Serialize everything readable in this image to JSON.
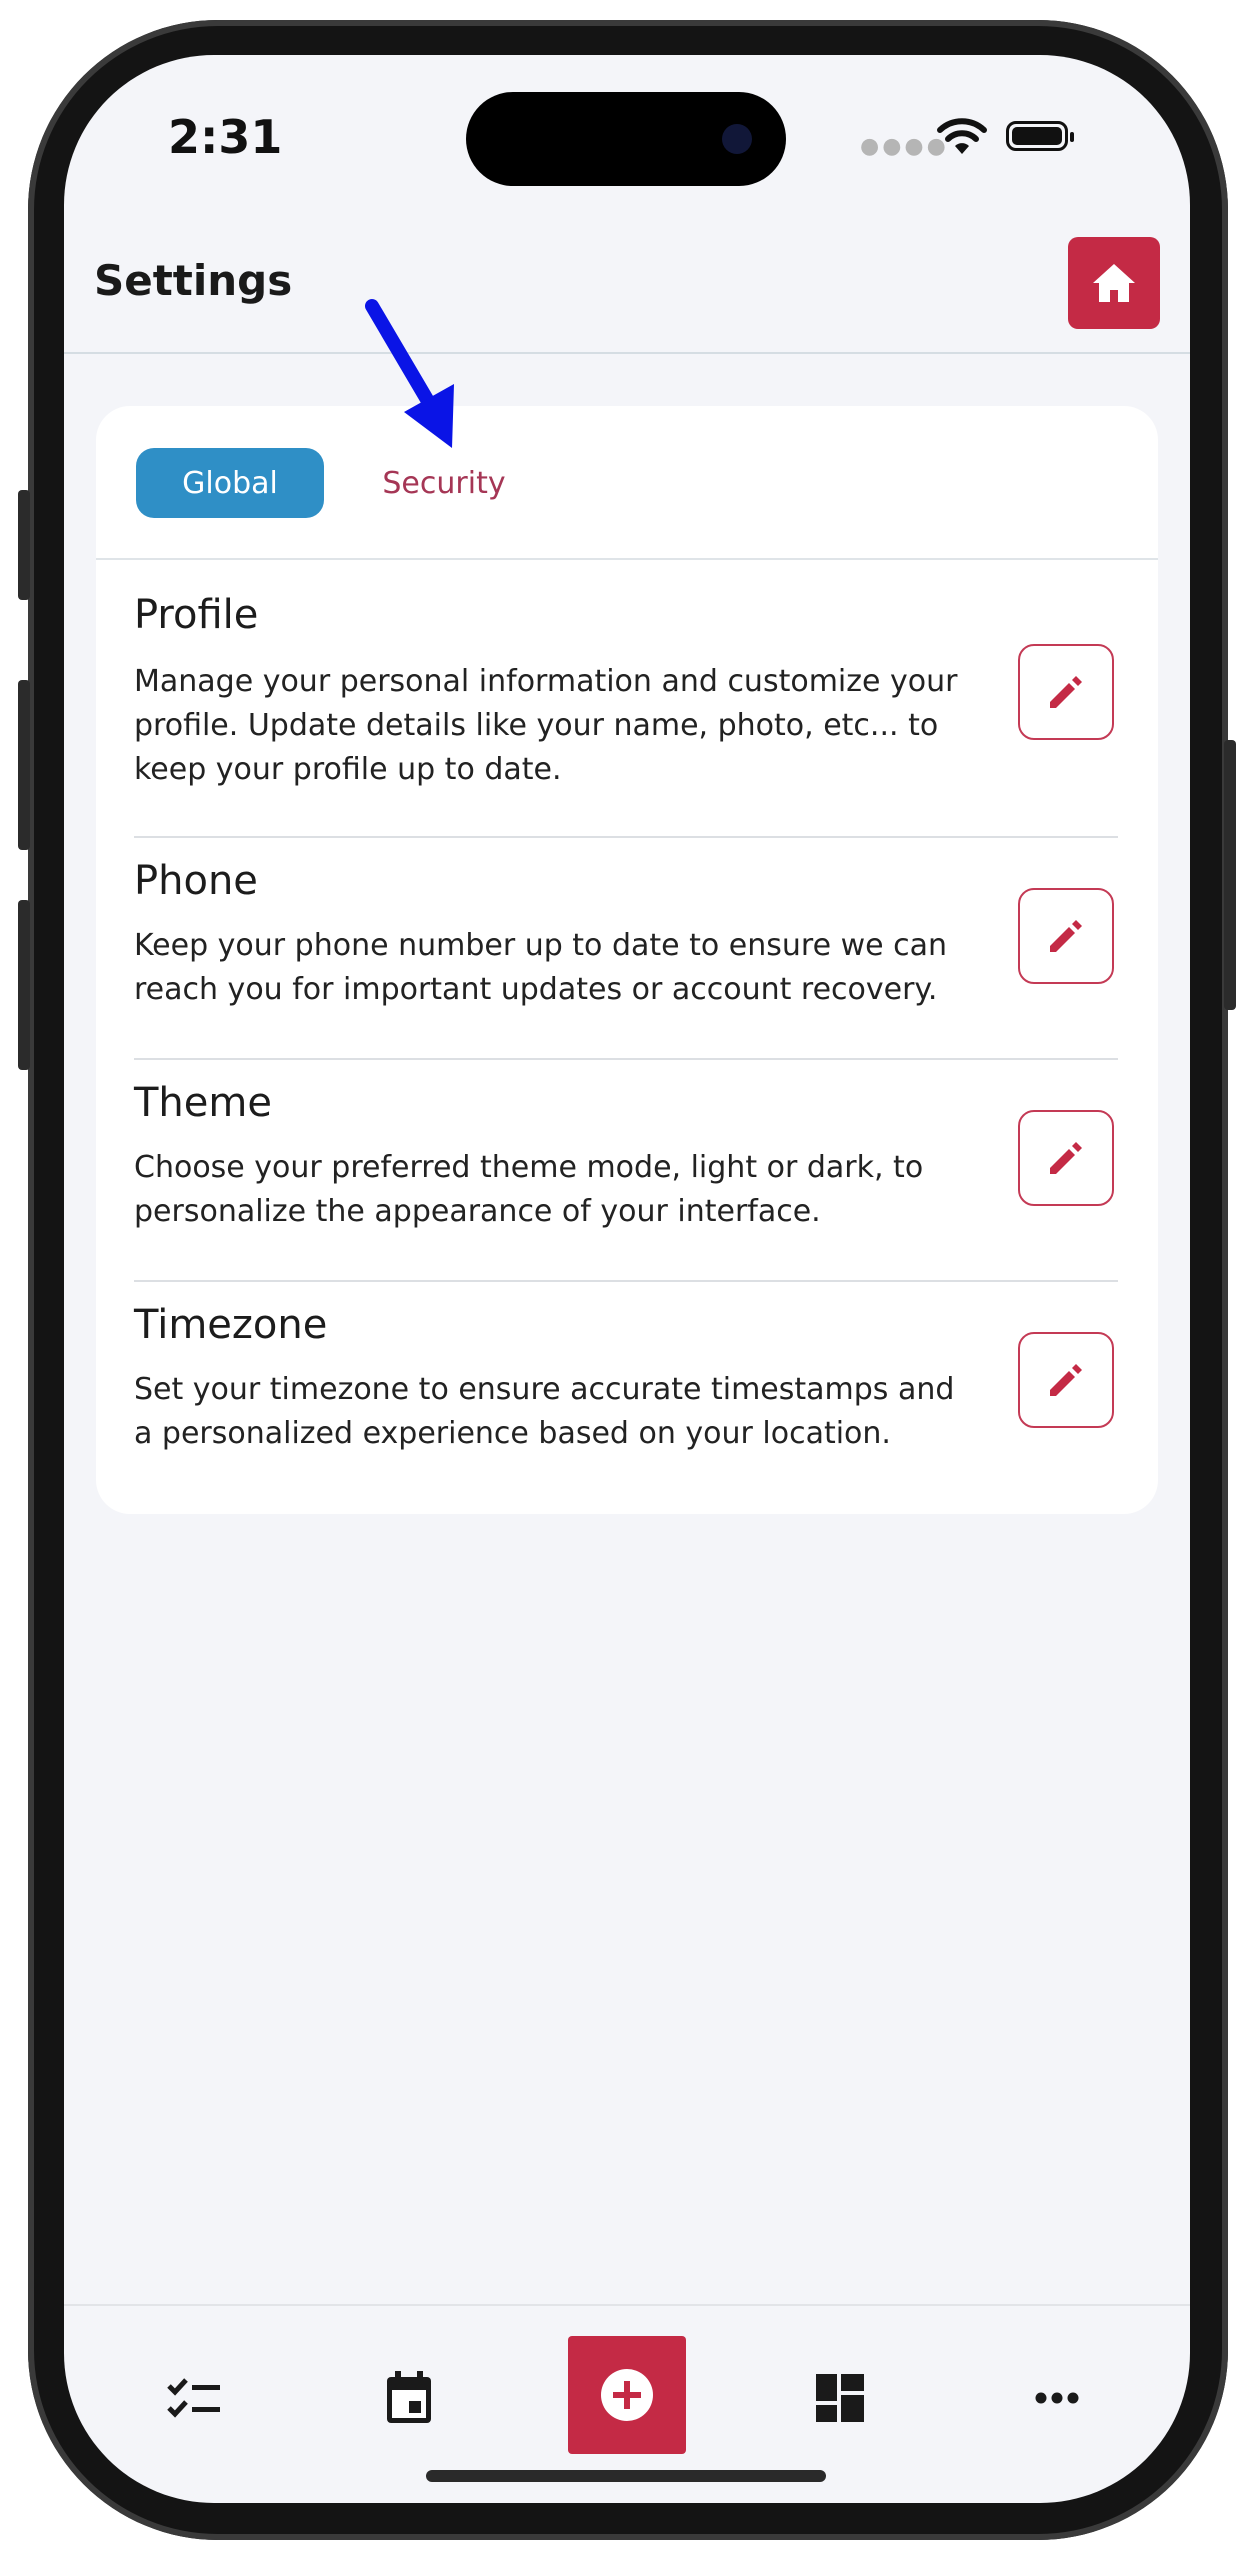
{
  "status_bar": {
    "time": "2:31"
  },
  "header": {
    "title": "Settings",
    "home_icon": "home-icon"
  },
  "tabs": [
    {
      "label": "Global",
      "active": true
    },
    {
      "label": "Security",
      "active": false
    }
  ],
  "sections": [
    {
      "title": "Profile",
      "lines": [
        "Manage your personal information and customize your",
        "profile. Update details like your name, photo, etc... to",
        "keep your profile up to date."
      ]
    },
    {
      "title": "Phone",
      "lines": [
        "Keep your phone number up to date to ensure we can",
        "reach you for important updates or account recovery."
      ]
    },
    {
      "title": "Theme",
      "lines": [
        "Choose your preferred theme mode, light or dark, to",
        "personalize the appearance of your interface."
      ]
    },
    {
      "title": "Timezone",
      "lines": [
        "Set your timezone to ensure accurate timestamps and",
        "a personalized experience based on your location."
      ]
    }
  ],
  "bottom_nav": {
    "items": [
      "checklist-icon",
      "calendar-icon",
      "add-icon",
      "dashboard-icon",
      "more-icon"
    ]
  },
  "colors": {
    "accent": "#c42a45",
    "tab_active": "#2f8fc6",
    "tab_inactive_text": "#a53655",
    "annotation_arrow": "#0a14e6"
  }
}
